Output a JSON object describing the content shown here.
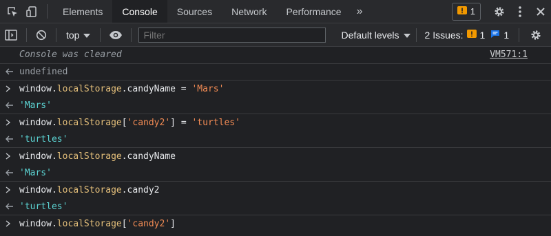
{
  "tabs": [
    {
      "label": "Elements"
    },
    {
      "label": "Console"
    },
    {
      "label": "Sources"
    },
    {
      "label": "Network"
    },
    {
      "label": "Performance"
    }
  ],
  "more_label": "»",
  "issue_badge": {
    "count": "1"
  },
  "toolbar": {
    "context": "top",
    "filter_placeholder": "Filter",
    "levels_label": "Default levels",
    "issues_label": "2 Issues:",
    "issues_warning_count": "1",
    "issues_info_count": "1"
  },
  "console": {
    "cleared_text": "Console was cleared",
    "cleared_source": "VM571:1",
    "undefined_text": "undefined",
    "entries": [
      {
        "obj": "window.",
        "prop": "localStorage",
        "rest": ".candyName = ",
        "str": "'Mars'",
        "result": "'Mars'"
      },
      {
        "obj": "window.",
        "prop": "localStorage",
        "br_open": "[",
        "key": "'candy2'",
        "br_close": "] = ",
        "str": "'turtles'",
        "result": "'turtles'"
      },
      {
        "obj": "window.",
        "prop": "localStorage",
        "rest": ".candyName",
        "result": "'Mars'"
      },
      {
        "obj": "window.",
        "prop": "localStorage",
        "rest": ".candy2",
        "result": "'turtles'"
      }
    ],
    "last": {
      "obj": "window.",
      "prop": "localStorage",
      "br_open": "[",
      "key": "'candy2'",
      "br_close": "]"
    }
  },
  "colors": {
    "background": "#202124",
    "toolbar": "#292a2d",
    "string": "#f28b54",
    "result_string": "#5cd5d4",
    "property": "#e5c07b",
    "warning": "#f29900",
    "info": "#1a73e8"
  }
}
